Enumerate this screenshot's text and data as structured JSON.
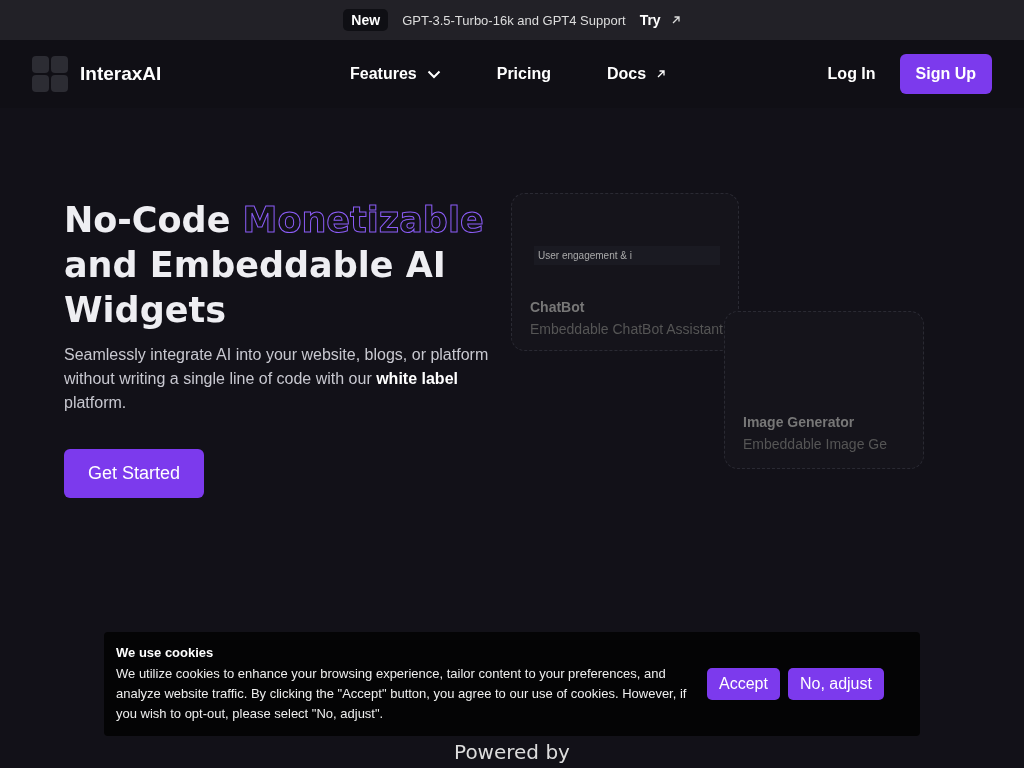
{
  "announcement": {
    "badge": "New",
    "text": "GPT-3.5-Turbo-16k and GPT4 Support",
    "link": "Try"
  },
  "nav": {
    "brand": "InteraxAI",
    "links": [
      {
        "label": "Features",
        "kind": "dropdown"
      },
      {
        "label": "Pricing",
        "kind": "plain"
      },
      {
        "label": "Docs",
        "kind": "external"
      }
    ],
    "login": "Log In",
    "signup": "Sign Up"
  },
  "hero": {
    "title_start": "No-Code",
    "title_highlight": "Monetizable",
    "title_end": "and Embeddable AI Widgets",
    "description": "Seamlessly integrate AI into your website, blogs, or platform without writing a single line of code with our **white label** platform.",
    "cta": "Get Started"
  },
  "widgets": [
    {
      "title": "ChatBot",
      "subtitle": "Embeddable ChatBot Assistant",
      "input": "User engagement & i"
    },
    {
      "title": "Image Generator",
      "subtitle": "Embeddable Image Ge"
    }
  ],
  "powered_by": "Powered by",
  "cookie_banner": {
    "title": "We use cookies",
    "text": "We utilize cookies to enhance your browsing experience, tailor content to your preferences, and analyze website traffic. By clicking the \"Accept\" button, you agree to our use of cookies. However, if you wish to opt-out, please select \"No, adjust\".",
    "buttons": [
      "Accept",
      "No, adjust"
    ]
  }
}
